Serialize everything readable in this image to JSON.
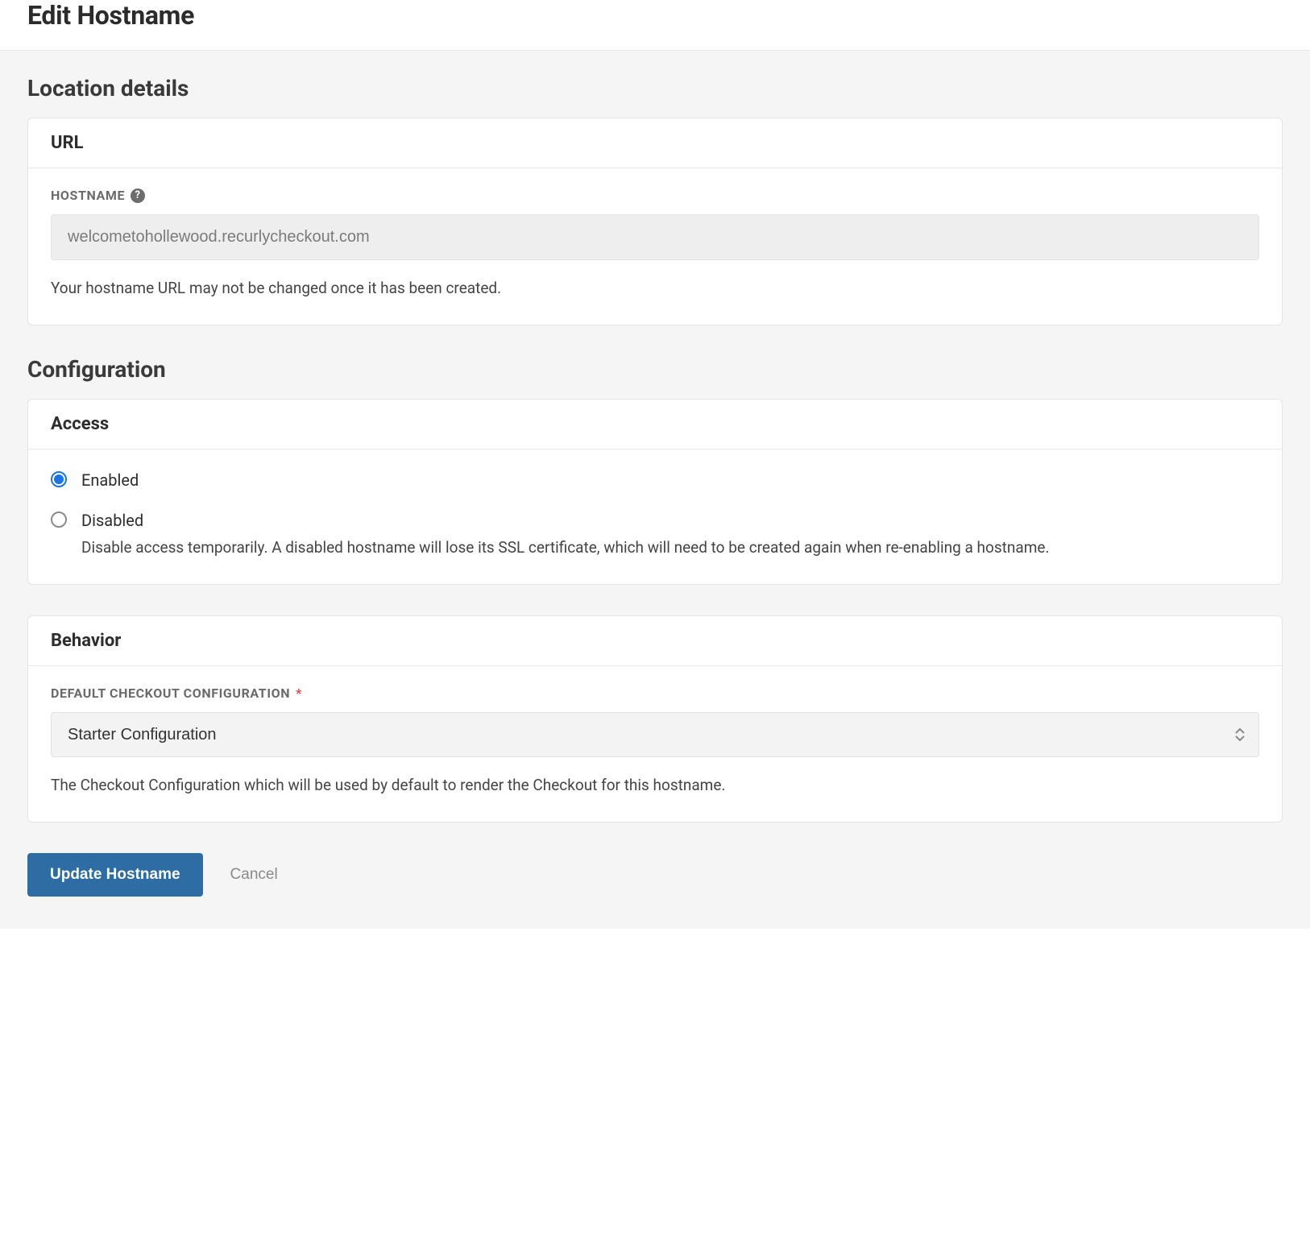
{
  "page": {
    "title": "Edit Hostname"
  },
  "location": {
    "section_title": "Location details",
    "url_panel_title": "URL",
    "hostname_label": "HOSTNAME",
    "hostname_value": "welcometohollewood.recurlycheckout.com",
    "hostname_help": "Your hostname URL may not be changed once it has been created."
  },
  "configuration": {
    "section_title": "Configuration",
    "access": {
      "panel_title": "Access",
      "enabled_label": "Enabled",
      "disabled_label": "Disabled",
      "disabled_desc": "Disable access temporarily. A disabled hostname will lose its SSL certificate, which will need to be created again when re-enabling a hostname.",
      "selected": "enabled"
    },
    "behavior": {
      "panel_title": "Behavior",
      "default_config_label": "DEFAULT CHECKOUT CONFIGURATION",
      "selected_value": "Starter Configuration",
      "help": "The Checkout Configuration which will be used by default to render the Checkout for this hostname."
    }
  },
  "actions": {
    "submit_label": "Update Hostname",
    "cancel_label": "Cancel"
  }
}
